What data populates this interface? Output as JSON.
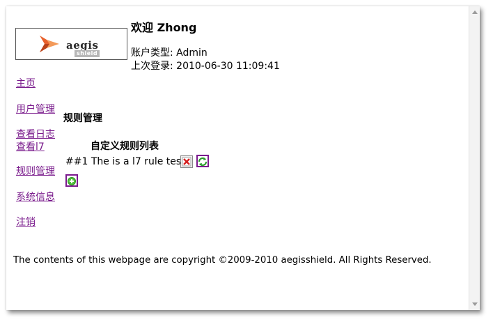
{
  "logo": {
    "text": "aegis",
    "subtext": "shield"
  },
  "header": {
    "welcome": "欢迎 Zhong",
    "account_type": "账户类型: Admin",
    "last_login": "上次登录: 2010-06-30 11:09:41"
  },
  "nav": {
    "items": [
      {
        "label": "主页"
      },
      {
        "label": "用户管理"
      },
      {
        "label": "查看日志"
      },
      {
        "label": "查看l7"
      },
      {
        "label": "规则管理"
      },
      {
        "label": "系统信息"
      },
      {
        "label": "注销"
      }
    ]
  },
  "main": {
    "section_title": "规则管理",
    "list_title": "自定义规则列表",
    "rules": [
      {
        "text": "##1 The is a l7 rule test"
      }
    ]
  },
  "icons": {
    "delete": "delete-icon",
    "refresh": "refresh-icon",
    "add": "add-icon"
  },
  "colors": {
    "link": "#7a1b8c",
    "logo_accent": "#e8612c"
  },
  "footer": {
    "copyright": "The contents of this webpage are copyright ©2009-2010 aegisshield. All Rights Reserved."
  }
}
